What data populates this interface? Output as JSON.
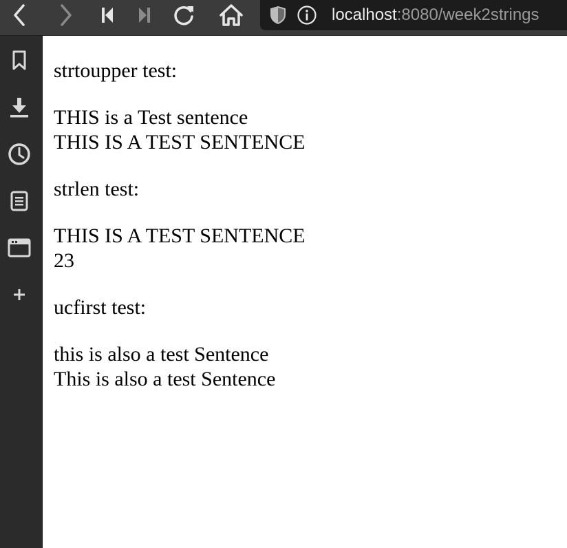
{
  "browser": {
    "url_host": "localhost",
    "url_rest": ":8080/week2strings"
  },
  "content": {
    "section1_heading": "strtoupper test:",
    "section1_input": "THIS is a Test sentence",
    "section1_output": "THIS IS A TEST SENTENCE",
    "section2_heading": "strlen test:",
    "section2_input": "THIS IS A TEST SENTENCE",
    "section2_output": "23",
    "section3_heading": "ucfirst test:",
    "section3_input": "this is also a test Sentence",
    "section3_output": "This is also a test Sentence"
  },
  "colors": {
    "toolbar_bg": "#3b3b3b",
    "sidebar_bg": "#2b2b2b",
    "urlbar_bg": "#1c1c1c",
    "icon_color": "#d8d8d8",
    "icon_disabled": "#8a8a8a"
  },
  "icons": {
    "toolbar": [
      "back-icon",
      "forward-icon",
      "skip-back-icon",
      "skip-forward-icon",
      "reload-icon",
      "home-icon",
      "shield-icon",
      "info-icon"
    ],
    "sidebar": [
      "bookmark-icon",
      "download-icon",
      "history-icon",
      "reading-list-icon",
      "tabs-icon",
      "add-icon"
    ]
  }
}
